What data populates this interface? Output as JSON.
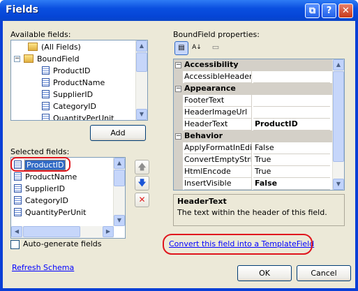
{
  "window": {
    "title": "Fields"
  },
  "available_fields": {
    "label": "Available fields:",
    "tree": [
      {
        "label": "(All Fields)",
        "kind": "folder",
        "level": 1
      },
      {
        "label": "BoundField",
        "kind": "folder",
        "level": 0,
        "expanded": true
      },
      {
        "label": "ProductID",
        "kind": "field",
        "level": 1
      },
      {
        "label": "ProductName",
        "kind": "field",
        "level": 1
      },
      {
        "label": "SupplierID",
        "kind": "field",
        "level": 1
      },
      {
        "label": "CategoryID",
        "kind": "field",
        "level": 1
      },
      {
        "label": "QuantityPerUnit",
        "kind": "field",
        "level": 1
      }
    ]
  },
  "add_button": {
    "label": "Add"
  },
  "selected_fields": {
    "label": "Selected fields:",
    "items": [
      "ProductID",
      "ProductName",
      "SupplierID",
      "CategoryID",
      "QuantityPerUnit"
    ],
    "selected": "ProductID"
  },
  "auto_generate": {
    "label": "Auto-generate fields",
    "checked": false
  },
  "refresh_schema": {
    "label": "Refresh Schema"
  },
  "properties": {
    "label": "BoundField properties:",
    "categories": [
      {
        "name": "Accessibility",
        "rows": [
          {
            "name": "AccessibleHeaderTe",
            "value": ""
          }
        ]
      },
      {
        "name": "Appearance",
        "rows": [
          {
            "name": "FooterText",
            "value": ""
          },
          {
            "name": "HeaderImageUrl",
            "value": ""
          },
          {
            "name": "HeaderText",
            "value": "ProductID",
            "bold": true
          }
        ]
      },
      {
        "name": "Behavior",
        "rows": [
          {
            "name": "ApplyFormatInEditM",
            "value": "False"
          },
          {
            "name": "ConvertEmptyString",
            "value": "True"
          },
          {
            "name": "HtmlEncode",
            "value": "True"
          },
          {
            "name": "InsertVisible",
            "value": "False",
            "bold": true
          }
        ]
      }
    ],
    "description_title": "HeaderText",
    "description_text": "The text within the header of this field."
  },
  "convert_link": {
    "label": "Convert this field into a TemplateField"
  },
  "ok_button": {
    "label": "OK"
  },
  "cancel_button": {
    "label": "Cancel"
  },
  "colors": {
    "titlebar": "#0a4fe0",
    "client": "#ece9d8",
    "selection": "#316ac5",
    "highlight_oval": "#e0151d",
    "link": "#0000ff"
  }
}
